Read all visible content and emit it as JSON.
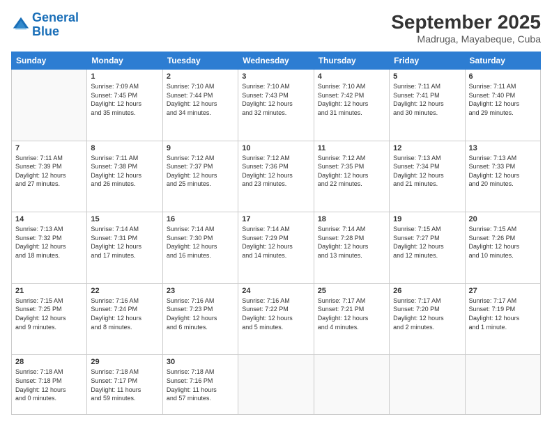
{
  "logo": {
    "line1": "General",
    "line2": "Blue"
  },
  "title": "September 2025",
  "location": "Madruga, Mayabeque, Cuba",
  "days_header": [
    "Sunday",
    "Monday",
    "Tuesday",
    "Wednesday",
    "Thursday",
    "Friday",
    "Saturday"
  ],
  "weeks": [
    [
      {
        "day": "",
        "info": ""
      },
      {
        "day": "1",
        "info": "Sunrise: 7:09 AM\nSunset: 7:45 PM\nDaylight: 12 hours\nand 35 minutes."
      },
      {
        "day": "2",
        "info": "Sunrise: 7:10 AM\nSunset: 7:44 PM\nDaylight: 12 hours\nand 34 minutes."
      },
      {
        "day": "3",
        "info": "Sunrise: 7:10 AM\nSunset: 7:43 PM\nDaylight: 12 hours\nand 32 minutes."
      },
      {
        "day": "4",
        "info": "Sunrise: 7:10 AM\nSunset: 7:42 PM\nDaylight: 12 hours\nand 31 minutes."
      },
      {
        "day": "5",
        "info": "Sunrise: 7:11 AM\nSunset: 7:41 PM\nDaylight: 12 hours\nand 30 minutes."
      },
      {
        "day": "6",
        "info": "Sunrise: 7:11 AM\nSunset: 7:40 PM\nDaylight: 12 hours\nand 29 minutes."
      }
    ],
    [
      {
        "day": "7",
        "info": "Sunrise: 7:11 AM\nSunset: 7:39 PM\nDaylight: 12 hours\nand 27 minutes."
      },
      {
        "day": "8",
        "info": "Sunrise: 7:11 AM\nSunset: 7:38 PM\nDaylight: 12 hours\nand 26 minutes."
      },
      {
        "day": "9",
        "info": "Sunrise: 7:12 AM\nSunset: 7:37 PM\nDaylight: 12 hours\nand 25 minutes."
      },
      {
        "day": "10",
        "info": "Sunrise: 7:12 AM\nSunset: 7:36 PM\nDaylight: 12 hours\nand 23 minutes."
      },
      {
        "day": "11",
        "info": "Sunrise: 7:12 AM\nSunset: 7:35 PM\nDaylight: 12 hours\nand 22 minutes."
      },
      {
        "day": "12",
        "info": "Sunrise: 7:13 AM\nSunset: 7:34 PM\nDaylight: 12 hours\nand 21 minutes."
      },
      {
        "day": "13",
        "info": "Sunrise: 7:13 AM\nSunset: 7:33 PM\nDaylight: 12 hours\nand 20 minutes."
      }
    ],
    [
      {
        "day": "14",
        "info": "Sunrise: 7:13 AM\nSunset: 7:32 PM\nDaylight: 12 hours\nand 18 minutes."
      },
      {
        "day": "15",
        "info": "Sunrise: 7:14 AM\nSunset: 7:31 PM\nDaylight: 12 hours\nand 17 minutes."
      },
      {
        "day": "16",
        "info": "Sunrise: 7:14 AM\nSunset: 7:30 PM\nDaylight: 12 hours\nand 16 minutes."
      },
      {
        "day": "17",
        "info": "Sunrise: 7:14 AM\nSunset: 7:29 PM\nDaylight: 12 hours\nand 14 minutes."
      },
      {
        "day": "18",
        "info": "Sunrise: 7:14 AM\nSunset: 7:28 PM\nDaylight: 12 hours\nand 13 minutes."
      },
      {
        "day": "19",
        "info": "Sunrise: 7:15 AM\nSunset: 7:27 PM\nDaylight: 12 hours\nand 12 minutes."
      },
      {
        "day": "20",
        "info": "Sunrise: 7:15 AM\nSunset: 7:26 PM\nDaylight: 12 hours\nand 10 minutes."
      }
    ],
    [
      {
        "day": "21",
        "info": "Sunrise: 7:15 AM\nSunset: 7:25 PM\nDaylight: 12 hours\nand 9 minutes."
      },
      {
        "day": "22",
        "info": "Sunrise: 7:16 AM\nSunset: 7:24 PM\nDaylight: 12 hours\nand 8 minutes."
      },
      {
        "day": "23",
        "info": "Sunrise: 7:16 AM\nSunset: 7:23 PM\nDaylight: 12 hours\nand 6 minutes."
      },
      {
        "day": "24",
        "info": "Sunrise: 7:16 AM\nSunset: 7:22 PM\nDaylight: 12 hours\nand 5 minutes."
      },
      {
        "day": "25",
        "info": "Sunrise: 7:17 AM\nSunset: 7:21 PM\nDaylight: 12 hours\nand 4 minutes."
      },
      {
        "day": "26",
        "info": "Sunrise: 7:17 AM\nSunset: 7:20 PM\nDaylight: 12 hours\nand 2 minutes."
      },
      {
        "day": "27",
        "info": "Sunrise: 7:17 AM\nSunset: 7:19 PM\nDaylight: 12 hours\nand 1 minute."
      }
    ],
    [
      {
        "day": "28",
        "info": "Sunrise: 7:18 AM\nSunset: 7:18 PM\nDaylight: 12 hours\nand 0 minutes."
      },
      {
        "day": "29",
        "info": "Sunrise: 7:18 AM\nSunset: 7:17 PM\nDaylight: 11 hours\nand 59 minutes."
      },
      {
        "day": "30",
        "info": "Sunrise: 7:18 AM\nSunset: 7:16 PM\nDaylight: 11 hours\nand 57 minutes."
      },
      {
        "day": "",
        "info": ""
      },
      {
        "day": "",
        "info": ""
      },
      {
        "day": "",
        "info": ""
      },
      {
        "day": "",
        "info": ""
      }
    ]
  ]
}
